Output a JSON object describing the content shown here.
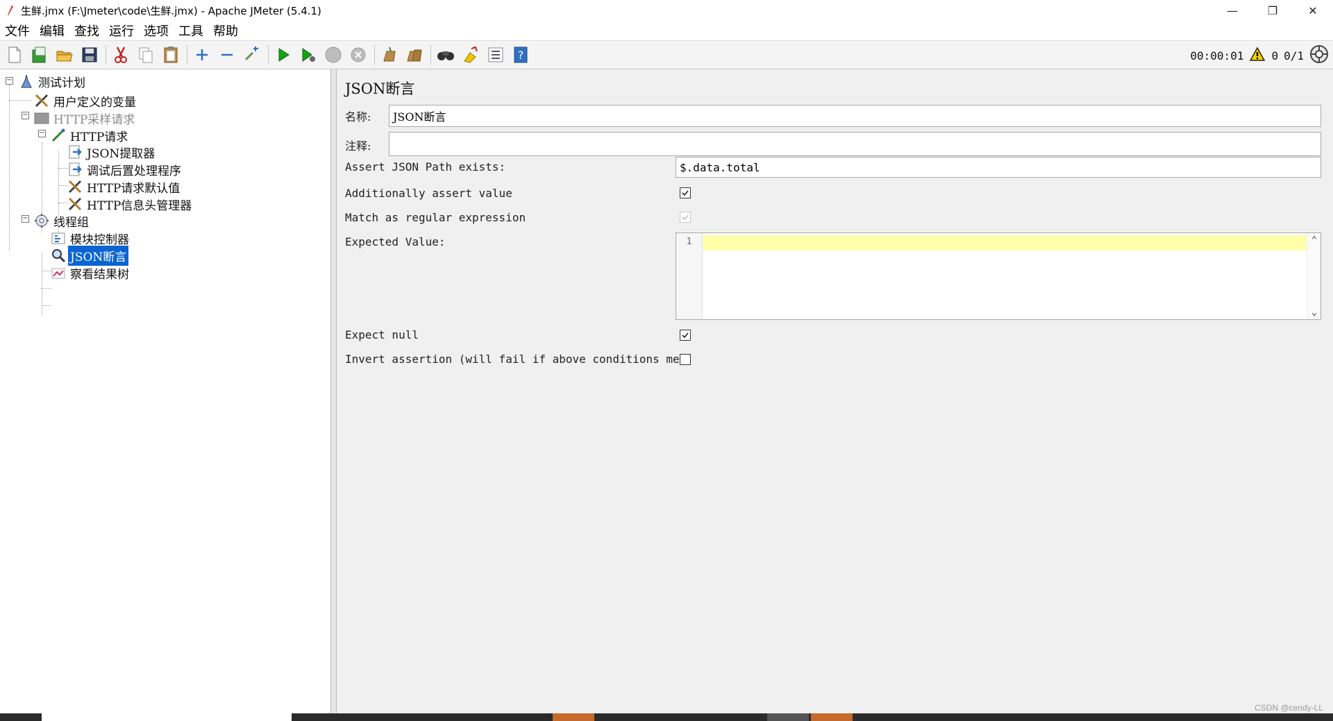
{
  "window": {
    "title": "生鲜.jmx (F:\\Jmeter\\code\\生鲜.jmx) - Apache JMeter (5.4.1)",
    "minimize": "—",
    "maximize": "❐",
    "close": "✕"
  },
  "menu": [
    "文件",
    "编辑",
    "查找",
    "运行",
    "选项",
    "工具",
    "帮助"
  ],
  "toolbar": {
    "buttons": [
      "new-icon",
      "templates-icon",
      "open-icon",
      "save-icon",
      "cut-icon",
      "copy-icon",
      "paste-icon",
      "expand-icon",
      "collapse-icon",
      "toggle-icon",
      "start-icon",
      "start-no-pause-icon",
      "stop-icon",
      "shutdown-icon",
      "clear-icon",
      "clear-all-icon",
      "search-icon",
      "reset-search-icon",
      "function-helper-icon",
      "help-icon"
    ],
    "timer": "00:00:01",
    "warning_count": "0",
    "threads": "0/1"
  },
  "tree": [
    {
      "label": "测试计划",
      "icon": "test-plan-icon"
    },
    {
      "label": "用户定义的变量",
      "icon": "config-icon"
    },
    {
      "label": "HTTP采样请求",
      "icon": "controller-icon"
    },
    {
      "label": "HTTP请求",
      "icon": "sampler-icon"
    },
    {
      "label": "JSON提取器",
      "icon": "post-processor-icon"
    },
    {
      "label": "调试后置处理程序",
      "icon": "post-processor-icon"
    },
    {
      "label": "HTTP请求默认值",
      "icon": "config-icon"
    },
    {
      "label": "HTTP信息头管理器",
      "icon": "config-icon"
    },
    {
      "label": "线程组",
      "icon": "thread-group-icon"
    },
    {
      "label": "模块控制器",
      "icon": "module-controller-icon"
    },
    {
      "label": "JSON断言",
      "icon": "assertion-icon"
    },
    {
      "label": "察看结果树",
      "icon": "listener-icon"
    }
  ],
  "panel": {
    "title": "JSON断言",
    "name_label": "名称:",
    "name_value": "JSON断言",
    "comment_label": "注释:",
    "comment_value": "",
    "path_label": "Assert JSON Path exists:",
    "path_value": "$.data.total",
    "additionally_label": "Additionally assert value",
    "additionally_checked": true,
    "regex_label": "Match as regular expression",
    "regex_checked": true,
    "regex_disabled": true,
    "expected_label": "Expected Value:",
    "expected_line_number": "1",
    "expected_value": "",
    "expect_null_label": "Expect null",
    "expect_null_checked": true,
    "invert_label": "Invert assertion (will fail if above conditions met)",
    "invert_checked": false
  },
  "watermark": "CSDN @cendy-LL",
  "colors": {
    "selection": "#0a64d2",
    "editor_highlight": "#ffffaa",
    "start_green": "#16a016"
  }
}
